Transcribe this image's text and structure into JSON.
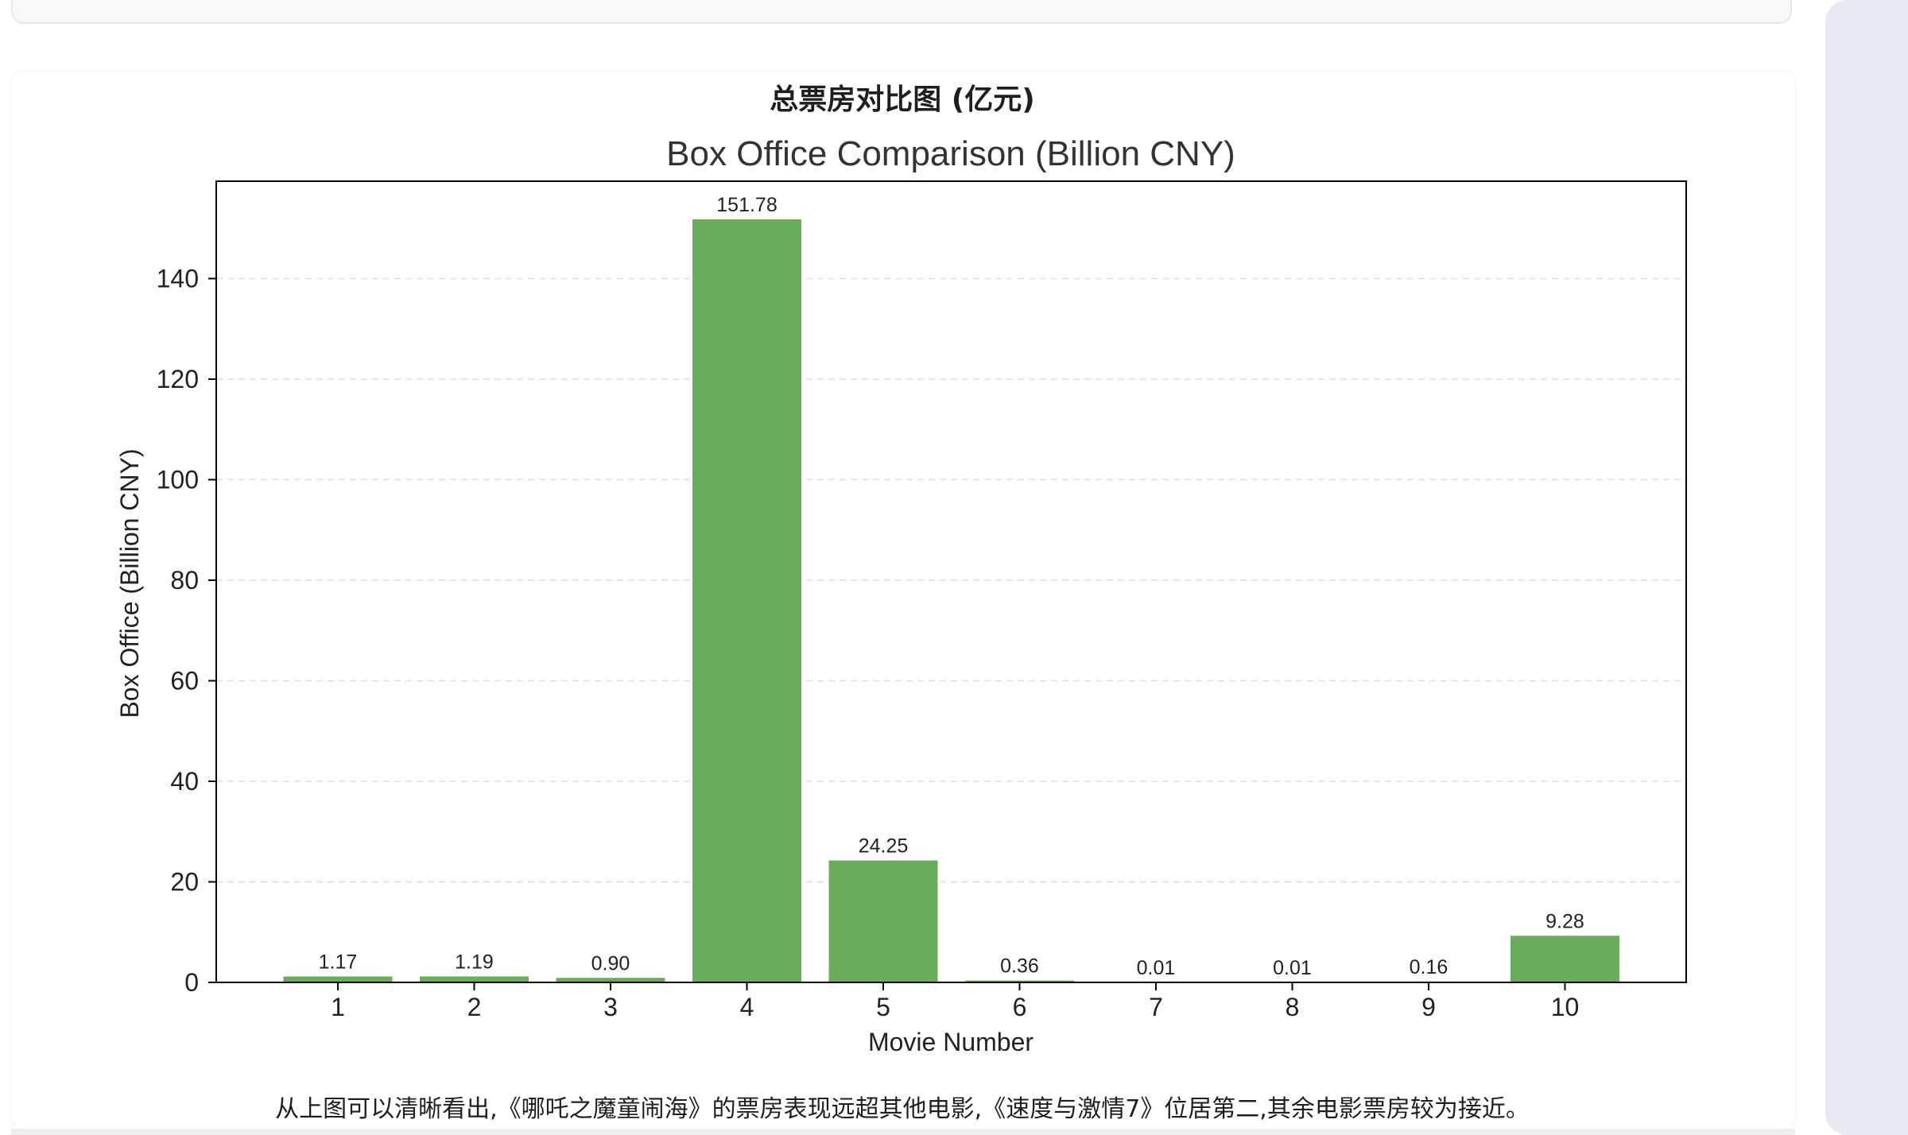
{
  "page": {
    "heading": "总票房对比图 (亿元)",
    "caption": "从上图可以清晰看出,《哪吒之魔童闹海》的票房表现远超其他电影,《速度与激情7》位居第二,其余电影票房较为接近。"
  },
  "colors": {
    "bar": "#6aac5b",
    "grid": "#dddddd",
    "axis": "#000000",
    "text": "#222222"
  },
  "chart_data": {
    "type": "bar",
    "title": "Box Office Comparison (Billion CNY)",
    "xlabel": "Movie Number",
    "ylabel": "Box Office (Billion CNY)",
    "categories": [
      "1",
      "2",
      "3",
      "4",
      "5",
      "6",
      "7",
      "8",
      "9",
      "10"
    ],
    "values": [
      1.17,
      1.19,
      0.9,
      151.78,
      24.25,
      0.36,
      0.01,
      0.01,
      0.16,
      9.28
    ],
    "value_labels": [
      "1.17",
      "1.19",
      "0.90",
      "151.78",
      "24.25",
      "0.36",
      "0.01",
      "0.01",
      "0.16",
      "9.28"
    ],
    "yticks": [
      0,
      20,
      40,
      60,
      80,
      100,
      120,
      140
    ],
    "ylim": [
      0,
      159.37
    ],
    "grid": "horizontal dashed"
  }
}
